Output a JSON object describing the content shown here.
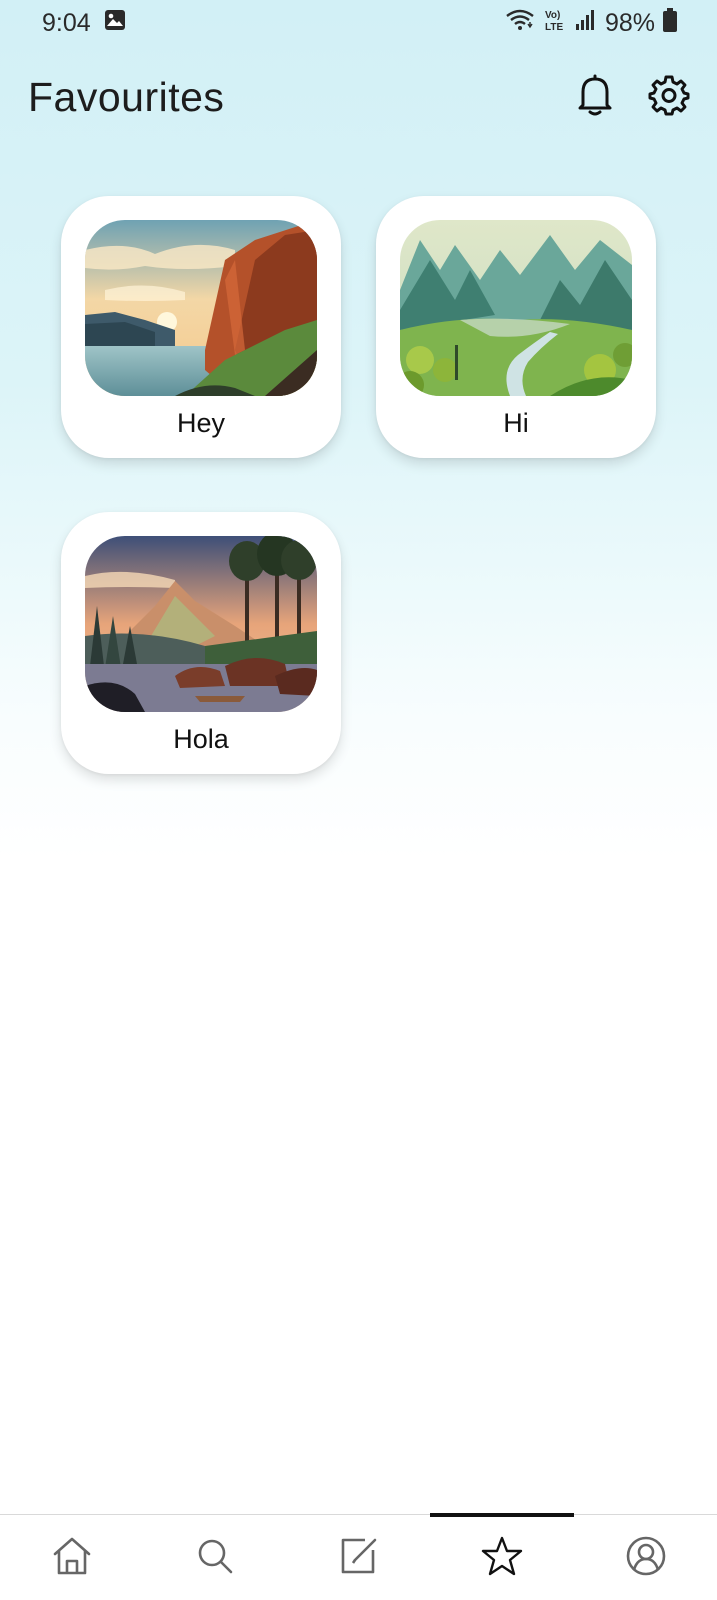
{
  "status_bar": {
    "time": "9:04",
    "battery": "98%",
    "icons": [
      "gallery-notification-icon",
      "wifi-icon",
      "volte-icon",
      "signal-icon",
      "battery-icon"
    ]
  },
  "header": {
    "title": "Favourites",
    "actions": [
      "bell-icon",
      "gear-icon"
    ]
  },
  "favourites": [
    {
      "label": "Hey",
      "image": "cliff-sunset-landscape"
    },
    {
      "label": "Hi",
      "image": "green-valley-landscape"
    },
    {
      "label": "Hola",
      "image": "lake-camp-landscape"
    }
  ],
  "bottom_nav": {
    "items": [
      "home-icon",
      "search-icon",
      "edit-icon",
      "star-icon",
      "profile-icon"
    ],
    "active": "star-icon"
  },
  "colors": {
    "background_top": "#d2f0f6",
    "card": "#ffffff",
    "text": "#111111",
    "active_indicator": "#111111"
  }
}
